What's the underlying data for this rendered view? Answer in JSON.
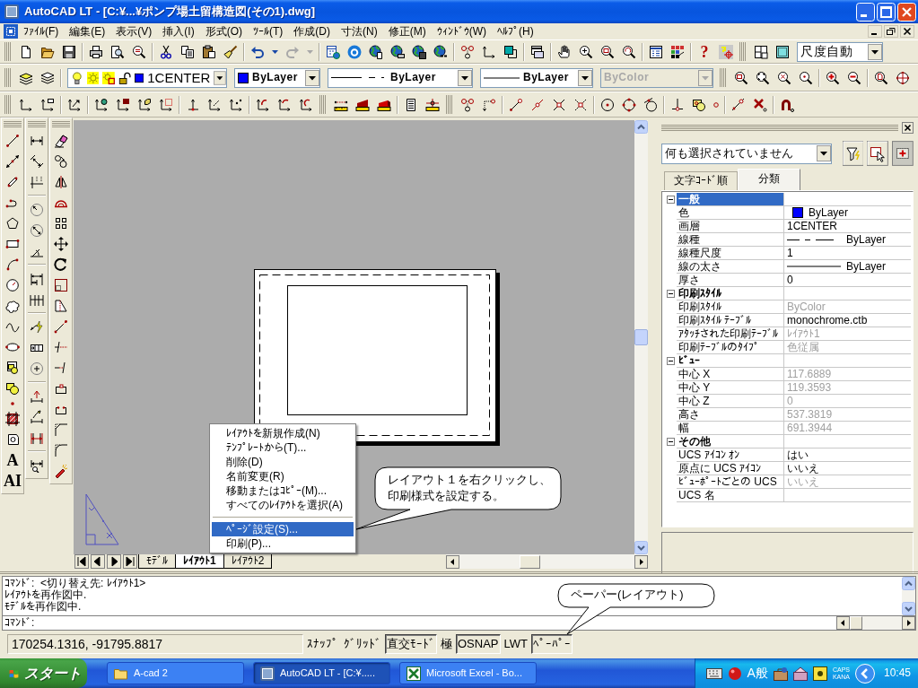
{
  "window": {
    "title": "AutoCAD LT - [C:¥...¥ポンプ場土留構造図(その1).dwg]"
  },
  "menu_bar": [
    "ﾌｧｲﾙ(F)",
    "編集(E)",
    "表示(V)",
    "挿入(I)",
    "形式(O)",
    "ﾂｰﾙ(T)",
    "作成(D)",
    "寸法(N)",
    "修正(M)",
    "ｳｨﾝﾄﾞｳ(W)",
    "ﾍﾙﾌﾟ(H)"
  ],
  "toolbars": {
    "help_glyph": "?",
    "layer": {
      "value": "1CENTER",
      "color": "#0000ff",
      "disabled": false
    },
    "color": {
      "value": "ByLayer",
      "color": "#0000ff",
      "disabled": false
    },
    "linetype": {
      "value": "ByLayer",
      "disabled": false
    },
    "lineweight": {
      "value": "ByLayer",
      "disabled": false
    },
    "plot_style": {
      "value": "ByColor",
      "disabled": true
    },
    "dimension_style": {
      "value": "尺度自動",
      "disabled": false
    }
  },
  "draw_toolbar": {
    "glyph_buttons": [
      "A",
      "AI"
    ]
  },
  "layout_tabs": [
    {
      "label": "ﾓﾃﾞﾙ",
      "selected": false
    },
    {
      "label": "ﾚｲｱｳﾄ1",
      "selected": true
    },
    {
      "label": "ﾚｲｱｳﾄ2",
      "selected": false
    }
  ],
  "context_menu": [
    {
      "kind": "item",
      "label": "ﾚｲｱｳﾄを新規作成(N)",
      "selected": false
    },
    {
      "kind": "item",
      "label": "ﾃﾝﾌﾟﾚｰﾄから(T)...",
      "selected": false
    },
    {
      "kind": "item",
      "label": "削除(D)",
      "selected": false
    },
    {
      "kind": "item",
      "label": "名前変更(R)",
      "selected": false
    },
    {
      "kind": "item",
      "label": "移動またはｺﾋﾟｰ(M)...",
      "selected": false
    },
    {
      "kind": "item",
      "label": "すべてのﾚｲｱｳﾄを選択(A)",
      "selected": false
    },
    {
      "kind": "separator"
    },
    {
      "kind": "item",
      "label": "ﾍﾟｰｼﾞ設定(S)...",
      "selected": true
    },
    {
      "kind": "item",
      "label": "印刷(P)...",
      "selected": false
    }
  ],
  "callouts": [
    {
      "text": "レイアウト１を右クリックし、印刷様式を設定する。"
    },
    {
      "text": "ペーパー(レイアウト)"
    }
  ],
  "properties": {
    "selection": "何も選択されていません",
    "tabs": [
      {
        "label": "文字ｺｰﾄﾞ順",
        "selected": false
      },
      {
        "label": "分類",
        "selected": true
      }
    ],
    "groups": [
      {
        "title": "一般",
        "expanded": true,
        "selected": true,
        "rows": [
          {
            "name": "色",
            "value": "ByLayer",
            "kind": "color",
            "color": "#0000ff",
            "disabled": false
          },
          {
            "name": "画層",
            "value": "1CENTER",
            "kind": "text",
            "disabled": false
          },
          {
            "name": "線種",
            "value": "ByLayer",
            "kind": "linetype",
            "disabled": false
          },
          {
            "name": "線種尺度",
            "value": "1",
            "kind": "text",
            "disabled": false
          },
          {
            "name": "線の太さ",
            "value": "ByLayer",
            "kind": "lineweight",
            "disabled": false
          },
          {
            "name": "厚さ",
            "value": "0",
            "kind": "text",
            "disabled": false
          }
        ]
      },
      {
        "title": "印刷ｽﾀｲﾙ",
        "expanded": true,
        "selected": false,
        "rows": [
          {
            "name": "印刷ｽﾀｲﾙ",
            "value": "ByColor",
            "kind": "text",
            "disabled": true
          },
          {
            "name": "印刷ｽﾀｲﾙ ﾃｰﾌﾞﾙ",
            "value": "monochrome.ctb",
            "kind": "text",
            "disabled": false
          },
          {
            "name": "ｱﾀｯﾁされた印刷ﾃｰﾌﾞﾙ",
            "value": "ﾚｲｱｳﾄ1",
            "kind": "text",
            "disabled": true
          },
          {
            "name": "印刷ﾃｰﾌﾞﾙのﾀｲﾌﾟ",
            "value": "色従属",
            "kind": "text",
            "disabled": true
          }
        ]
      },
      {
        "title": "ﾋﾞｭｰ",
        "expanded": true,
        "selected": false,
        "rows": [
          {
            "name": "中心 X",
            "value": "117.6889",
            "kind": "text",
            "disabled": true
          },
          {
            "name": "中心 Y",
            "value": "119.3593",
            "kind": "text",
            "disabled": true
          },
          {
            "name": "中心 Z",
            "value": "0",
            "kind": "text",
            "disabled": true
          },
          {
            "name": "高さ",
            "value": "537.3819",
            "kind": "text",
            "disabled": true
          },
          {
            "name": "幅",
            "value": "691.3944",
            "kind": "text",
            "disabled": true
          }
        ]
      },
      {
        "title": "その他",
        "expanded": true,
        "selected": false,
        "rows": [
          {
            "name": "UCS ｱｲｺﾝ ｵﾝ",
            "value": "はい",
            "kind": "text",
            "disabled": false
          },
          {
            "name": "原点に UCS ｱｲｺﾝ",
            "value": "いいえ",
            "kind": "text",
            "disabled": false
          },
          {
            "name": "ﾋﾞｭｰﾎﾟｰﾄごとの UCS",
            "value": "いいえ",
            "kind": "text",
            "disabled": true
          },
          {
            "name": "UCS 名"
          }
        ]
      }
    ]
  },
  "command_line": {
    "history": [
      "ｺﾏﾝﾄﾞ:  <切り替え先: ﾚｲｱｳﾄ1>",
      "ﾚｲｱｳﾄを再作図中.",
      "ﾓﾃﾞﾙを再作図中."
    ],
    "prompt": "ｺﾏﾝﾄﾞ:"
  },
  "status_bar": {
    "coordinates": "170254.1316, -91795.8817",
    "toggles": [
      {
        "label": "ｽﾅｯﾌﾟ",
        "on": false
      },
      {
        "label": "ｸﾞﾘｯﾄﾞ",
        "on": false
      },
      {
        "label": "直交ﾓｰﾄﾞ",
        "on": true
      },
      {
        "label": "極",
        "on": false
      },
      {
        "label": "OSNAP",
        "on": true
      },
      {
        "label": "LWT",
        "on": false
      },
      {
        "label": "ﾍﾟｰﾊﾟｰ",
        "on": true
      }
    ]
  },
  "taskbar": {
    "start": "スタート",
    "tasks": [
      {
        "kind": "folder",
        "label": "A-cad 2",
        "selected": false
      },
      {
        "kind": "cad",
        "label": "AutoCAD LT - [C:¥.....",
        "selected": true
      },
      {
        "kind": "spreadsheet",
        "label": "Microsoft Excel - Bo...",
        "selected": false
      }
    ],
    "tray": {
      "ime": "A般",
      "caps": "CAPS",
      "kana": "KANA",
      "clock": "10:45"
    }
  }
}
